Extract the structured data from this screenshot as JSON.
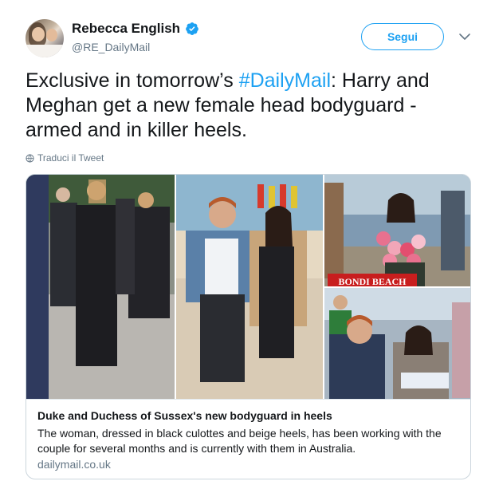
{
  "author": {
    "display_name": "Rebecca English",
    "handle": "@RE_DailyMail",
    "verified": true
  },
  "follow_label": "Segui",
  "tweet": {
    "text_before": "Exclusive in tomorrow’s ",
    "hashtag": "#DailyMail",
    "text_after": ": Harry and Meghan get a new female head bodyguard - armed and in killer heels."
  },
  "translate_label": "Traduci il Tweet",
  "card": {
    "image_caption": "BONDI BEACH",
    "title": "Duke and Duchess of Sussex's new bodyguard in heels",
    "description": "The woman, dressed in black culottes and beige heels, has been working with the couple for several months and is currently with them in Australia.",
    "domain": "dailymail.co.uk"
  },
  "colors": {
    "accent": "#1da1f2",
    "text": "#14171a",
    "muted": "#657786",
    "border": "#ccd6dd"
  },
  "icons": [
    "verified-badge-icon",
    "chevron-down-icon",
    "globe-icon"
  ]
}
